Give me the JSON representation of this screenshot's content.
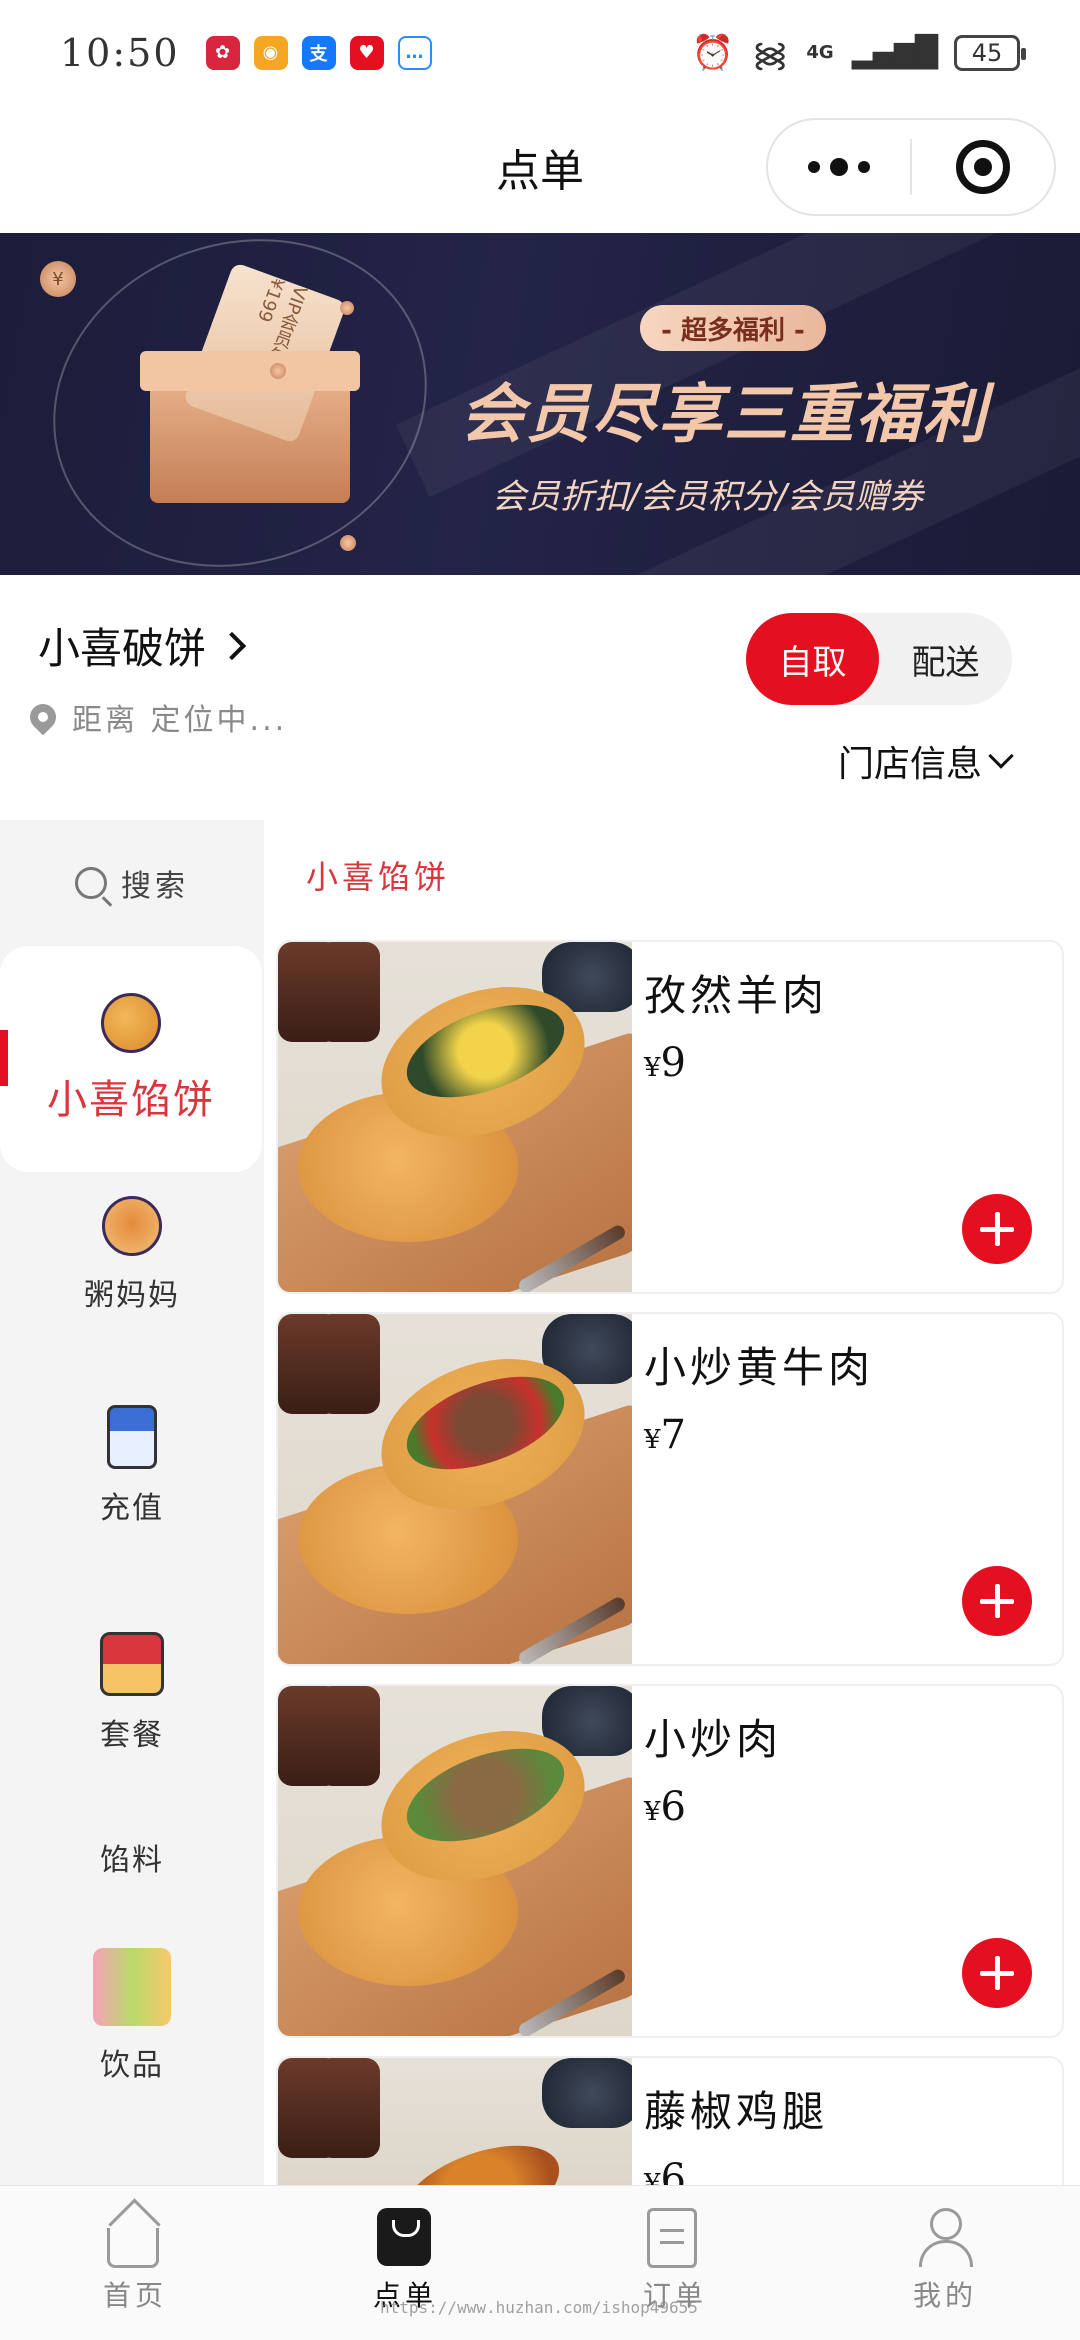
{
  "status_bar": {
    "time": "10:50",
    "network": "4G",
    "battery": "45",
    "app_icons": [
      "huawei-icon",
      "weibo-icon",
      "alipay-icon",
      "heart-app-icon",
      "chat-icon"
    ]
  },
  "nav": {
    "title": "点单"
  },
  "banner": {
    "tag": "- 超多福利 -",
    "title": "会员尽享三重福利",
    "subtitle": "会员折扣/会员积分/会员赠券",
    "card_text": "VIP会员年卡 ¥199"
  },
  "store": {
    "name": "小喜破饼",
    "distance": "距离 定位中...",
    "modes": [
      "自取",
      "配送"
    ],
    "active_mode": "自取",
    "info_label": "门店信息"
  },
  "sidebar": {
    "search_label": "搜索",
    "categories": [
      {
        "label": "小喜馅饼",
        "icon": "cookie-icon"
      },
      {
        "label": "粥妈妈",
        "icon": "bowl-icon"
      },
      {
        "label": "充值",
        "icon": "milk-icon"
      },
      {
        "label": "套餐",
        "icon": "combo-icon"
      },
      {
        "label": "馅料",
        "icon": ""
      },
      {
        "label": "饮品",
        "icon": "drinks-icon"
      }
    ],
    "active_category": "小喜馅饼"
  },
  "menu": {
    "section_title": "小喜馅饼",
    "currency": "¥",
    "products": [
      {
        "name": "孜然羊肉",
        "price": "9"
      },
      {
        "name": "小炒黄牛肉",
        "price": "7"
      },
      {
        "name": "小炒肉",
        "price": "6"
      },
      {
        "name": "藤椒鸡腿",
        "price": "6"
      }
    ]
  },
  "tabbar": {
    "tabs": [
      {
        "label": "首页",
        "icon": "home-icon"
      },
      {
        "label": "点单",
        "icon": "shopping-bag-icon"
      },
      {
        "label": "订单",
        "icon": "order-icon"
      },
      {
        "label": "我的",
        "icon": "profile-icon"
      }
    ],
    "active_tab": "点单"
  },
  "watermark": "https://www.huzhan.com/ishop49655",
  "colors": {
    "accent": "#e5101f",
    "category_active_text": "#d9363e",
    "banner_bg": "#1f2040"
  }
}
